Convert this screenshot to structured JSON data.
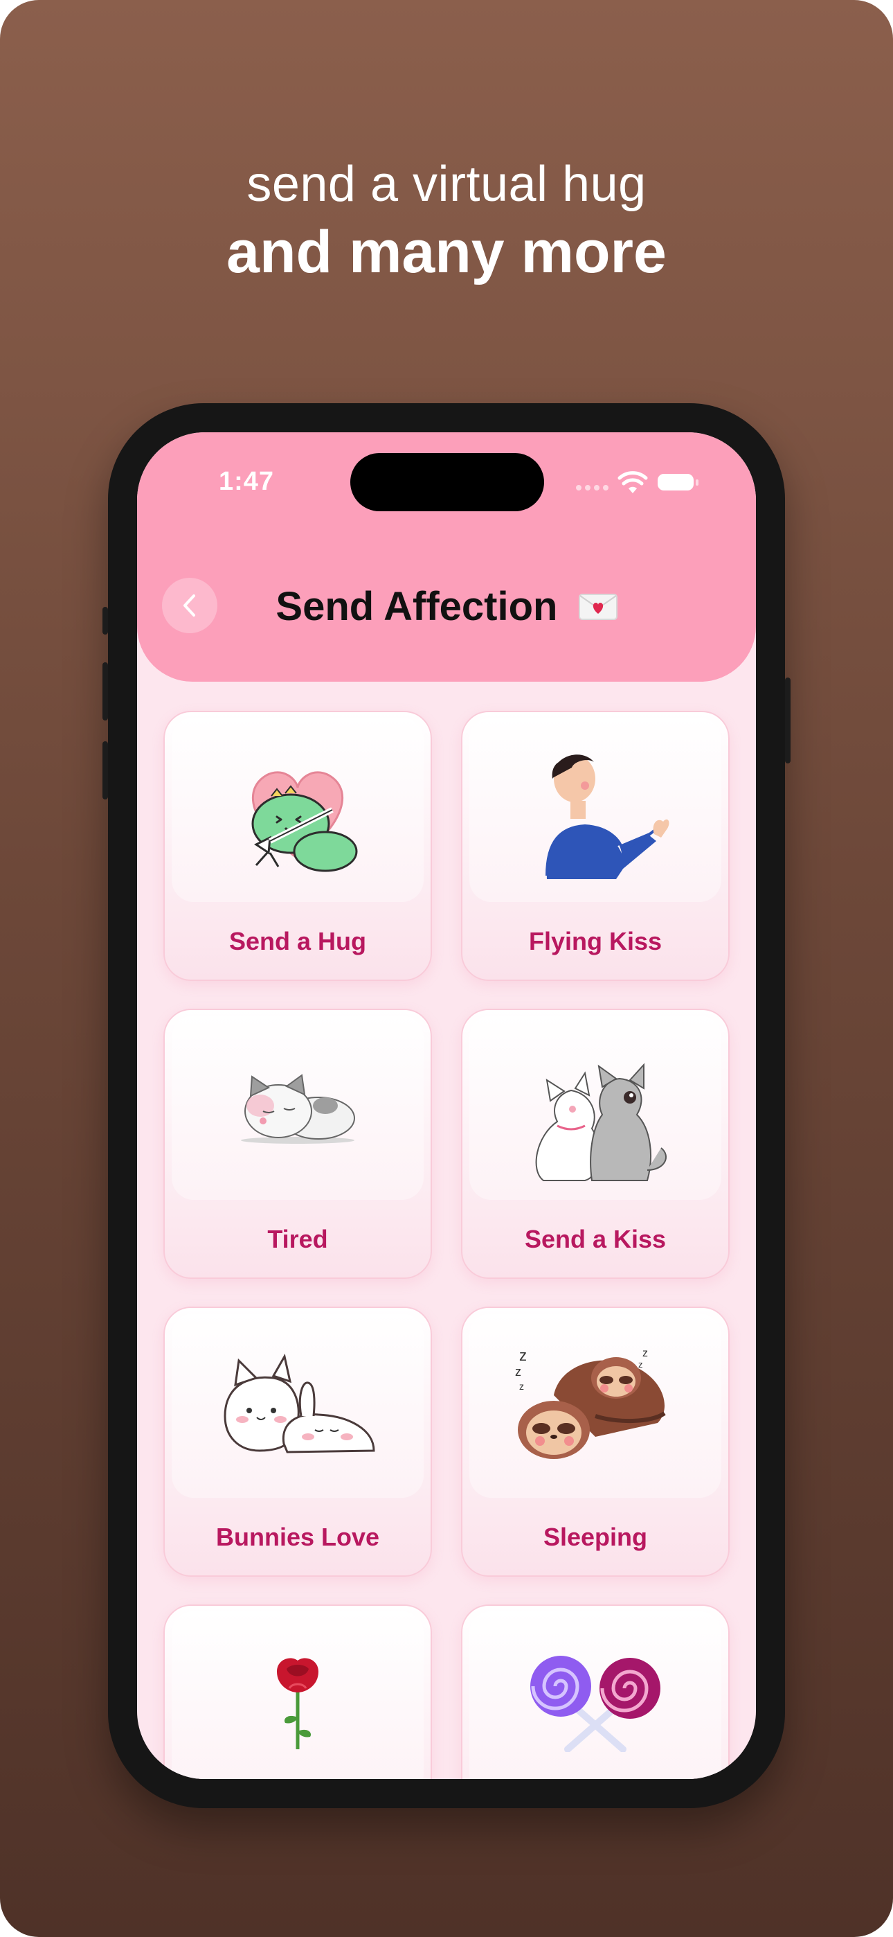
{
  "promo": {
    "line1": "send a virtual hug",
    "line2": "and many more"
  },
  "status": {
    "time": "1:47"
  },
  "header": {
    "title": "Send Affection"
  },
  "colors": {
    "header_pink": "#fc9fba",
    "label_magenta": "#b8185f",
    "background_brown": "#6d4839"
  },
  "cards": [
    {
      "label": "Send a Hug",
      "icon": "hug-dino-icon"
    },
    {
      "label": "Flying Kiss",
      "icon": "flying-kiss-icon"
    },
    {
      "label": "Tired",
      "icon": "tired-cat-icon"
    },
    {
      "label": "Send a Kiss",
      "icon": "kissing-cats-icon"
    },
    {
      "label": "Bunnies Love",
      "icon": "bunnies-love-icon"
    },
    {
      "label": "Sleeping",
      "icon": "sleeping-sloths-icon"
    },
    {
      "label": "",
      "icon": "rose-icon"
    },
    {
      "label": "",
      "icon": "lollipops-icon"
    }
  ]
}
